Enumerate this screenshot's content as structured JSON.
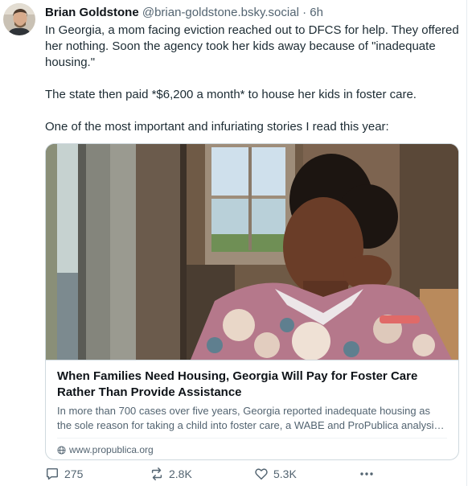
{
  "post": {
    "author_name": "Brian Goldstone",
    "author_handle": "@brian-goldstone.bsky.social",
    "separator": "·",
    "timestamp": "6h",
    "text_paragraphs": [
      "In Georgia, a mom facing eviction reached out to DFCS for help. They offered her nothing. Soon the agency took her kids away because of \"inadequate housing.\"",
      "The state then paid *$6,200 a month* to house her kids in foster care.",
      "One of the most important and infuriating stories I read this year:"
    ]
  },
  "link_card": {
    "title": "When Families Need Housing, Georgia Will Pay for Foster Care Rather Than Provide Assistance",
    "description": "In more than 700 cases over five years, Georgia reported inadequate housing as the sole reason for taking a child into foster care, a WABE and ProPublica analysis foun...",
    "domain": "www.propublica.org",
    "image_icon": "photo-woman-at-window",
    "domain_icon": "globe-icon"
  },
  "actions": {
    "reply_count": "275",
    "repost_count": "2.8K",
    "like_count": "5.3K",
    "reply_icon": "reply-icon",
    "repost_icon": "repost-icon",
    "like_icon": "heart-icon",
    "more_icon": "more-options-icon"
  },
  "colors": {
    "text": "#0f1419",
    "secondary_text": "#536471",
    "border": "#cfd9de",
    "background": "#ffffff"
  }
}
